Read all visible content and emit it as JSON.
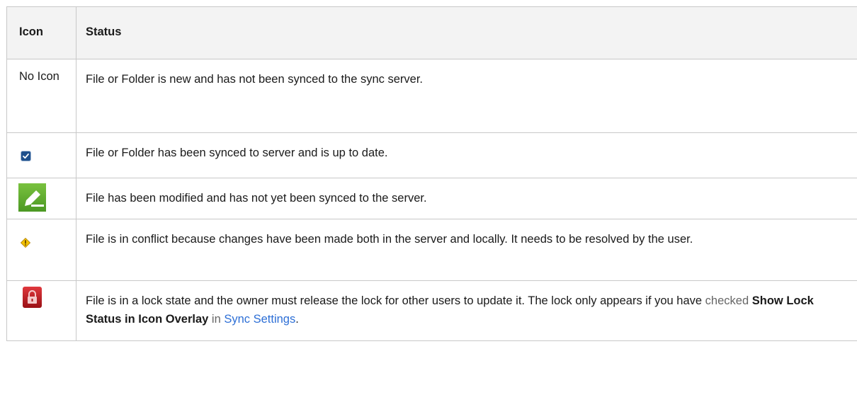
{
  "table": {
    "headers": {
      "icon": "Icon",
      "status": "Status"
    },
    "rows": [
      {
        "icon_text": "No Icon",
        "icon": "no-icon",
        "status": "File or Folder is new and has not been synced to the sync server."
      },
      {
        "icon": "synced-check-icon",
        "status": "File or Folder has been synced to server and is up to date."
      },
      {
        "icon": "modified-pencil-icon",
        "status": "File has been modified and has not yet been synced to the server."
      },
      {
        "icon": "conflict-warning-icon",
        "status": "File is in conflict because changes have been made both in the server and locally. It needs to be resolved by the user."
      },
      {
        "icon": "lock-icon",
        "status_parts": {
          "text1": "File is in a lock state and the owner must release the lock for other users to update it.  The lock only appears if you have ",
          "muted1": "checked",
          "space1": " ",
          "bold": "Show Lock Status in Icon Overlay",
          "muted2": " in ",
          "link": "Sync Settings",
          "end": "."
        }
      }
    ]
  },
  "colors": {
    "header_bg": "#f3f3f3",
    "border": "#c8c8c8",
    "link": "#2d6fd6",
    "check_blue": "#1d4f8c",
    "modified_green": "#5fae2e",
    "conflict_yellow": "#f2c200",
    "lock_red": "#c41d22"
  }
}
